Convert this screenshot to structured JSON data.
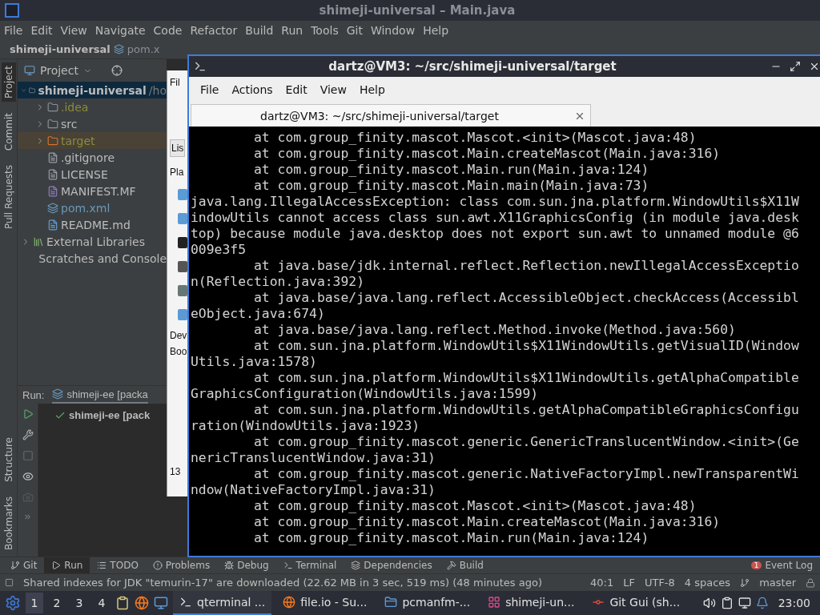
{
  "ide": {
    "title": "shimeji-universal – Main.java",
    "menu": [
      "File",
      "Edit",
      "View",
      "Navigate",
      "Code",
      "Refactor",
      "Build",
      "Run",
      "Tools",
      "Git",
      "Window",
      "Help"
    ],
    "breadcrumb": [
      {
        "label": "shimeji-universal",
        "kind": "project"
      },
      {
        "label": "pom.x",
        "kind": "maven"
      }
    ],
    "stripe_top": [
      {
        "label": "Project",
        "selected": true
      },
      {
        "label": "Commit",
        "selected": false
      },
      {
        "label": "Pull Requests",
        "selected": false
      }
    ],
    "stripe_bottom": [
      {
        "label": "Structure",
        "selected": false
      },
      {
        "label": "Bookmarks",
        "selected": false
      }
    ],
    "project_panel": {
      "title": "Project",
      "tree": [
        {
          "label": "shimeji-universal",
          "path": "/ho",
          "kind": "module",
          "expanded": true,
          "selected": true,
          "children": [
            {
              "label": ".idea",
              "kind": "folder",
              "color": "#8c8c3a",
              "expanded": false,
              "selected": false
            },
            {
              "label": "src",
              "kind": "folder",
              "color": "#bbbbbb",
              "expanded": false,
              "selected": false
            },
            {
              "label": "target",
              "kind": "excluded",
              "color": "#8c8c3a",
              "expanded": false,
              "selected": false
            },
            {
              "label": ".gitignore",
              "kind": "file",
              "color": "#bbbbbb",
              "selected": false
            },
            {
              "label": "LICENSE",
              "kind": "file",
              "color": "#bbbbbb",
              "selected": false
            },
            {
              "label": "MANIFEST.MF",
              "kind": "manifest",
              "color": "#bbbbbb",
              "selected": false
            },
            {
              "label": "pom.xml",
              "kind": "maven",
              "color": "#6897bb",
              "selected": false
            },
            {
              "label": "README.md",
              "kind": "markdown",
              "color": "#bbbbbb",
              "selected": false
            }
          ]
        },
        {
          "label": "External Libraries",
          "kind": "libraries",
          "expanded": false,
          "selected": false
        },
        {
          "label": "Scratches and Console",
          "kind": "scratches",
          "selected": false
        }
      ]
    },
    "run_panel": {
      "label": "Run:",
      "tab": "shimeji-ee [packa",
      "rows": [
        {
          "label": "shimeji-ee [pack",
          "succeeded": true
        }
      ]
    },
    "tool_tabs": [
      {
        "label": "Git",
        "kind": "git",
        "selected": false
      },
      {
        "label": "Run",
        "kind": "run",
        "selected": true
      },
      {
        "label": "TODO",
        "kind": "todo",
        "selected": false
      },
      {
        "label": "Problems",
        "kind": "problems",
        "selected": false
      },
      {
        "label": "Debug",
        "kind": "debug",
        "selected": false
      },
      {
        "label": "Terminal",
        "kind": "terminal",
        "selected": false
      },
      {
        "label": "Dependencies",
        "kind": "dependencies",
        "selected": false
      },
      {
        "label": "Build",
        "kind": "build",
        "selected": false
      }
    ],
    "event_log": {
      "label": "Event Log",
      "badge": "1"
    },
    "status_bar": {
      "message": "Shared indexes for JDK \"temurin-17\" are downloaded (22.62 MB in 3 sec, 519 ms) (48 minutes ago)",
      "items": [
        {
          "label": "40:1",
          "kind": "text"
        },
        {
          "label": "LF",
          "kind": "text"
        },
        {
          "label": "UTF-8",
          "kind": "text"
        },
        {
          "label": "4 spaces",
          "kind": "text"
        },
        {
          "label": "master",
          "kind": "branch"
        }
      ]
    }
  },
  "file_manager": {
    "menu_item": "Fil",
    "view_button": "Lis",
    "sections": [
      "Pla",
      "Dev",
      "Boo"
    ],
    "status": "13"
  },
  "terminal": {
    "title": "dartz@VM3: ~/src/shimeji-universal/target",
    "menu": [
      "File",
      "Actions",
      "Edit",
      "View",
      "Help"
    ],
    "tab": "dartz@VM3: ~/src/shimeji-universal/target",
    "lines": [
      "        at com.group_finity.mascot.Mascot.<init>(Mascot.java:48)",
      "        at com.group_finity.mascot.Main.createMascot(Main.java:316)",
      "        at com.group_finity.mascot.Main.run(Main.java:124)",
      "        at com.group_finity.mascot.Main.main(Main.java:73)",
      "java.lang.IllegalAccessException: class com.sun.jna.platform.WindowUtils$X11W",
      "indowUtils cannot access class sun.awt.X11GraphicsConfig (in module java.desk",
      "top) because module java.desktop does not export sun.awt to unnamed module @6",
      "009e3f5",
      "        at java.base/jdk.internal.reflect.Reflection.newIllegalAccessExceptio",
      "n(Reflection.java:392)",
      "        at java.base/java.lang.reflect.AccessibleObject.checkAccess(Accessibl",
      "eObject.java:674)",
      "        at java.base/java.lang.reflect.Method.invoke(Method.java:560)",
      "        at com.sun.jna.platform.WindowUtils$X11WindowUtils.getVisualID(Window",
      "Utils.java:1578)",
      "        at com.sun.jna.platform.WindowUtils$X11WindowUtils.getAlphaCompatible",
      "GraphicsConfiguration(WindowUtils.java:1599)",
      "        at com.sun.jna.platform.WindowUtils.getAlphaCompatibleGraphicsConfigu",
      "ration(WindowUtils.java:1923)",
      "        at com.group_finity.mascot.generic.GenericTranslucentWindow.<init>(Ge",
      "nericTranslucentWindow.java:31)",
      "        at com.group_finity.mascot.generic.NativeFactoryImpl.newTransparentWi",
      "ndow(NativeFactoryImpl.java:31)",
      "        at com.group_finity.mascot.Mascot.<init>(Mascot.java:48)",
      "        at com.group_finity.mascot.Main.createMascot(Main.java:316)",
      "        at com.group_finity.mascot.Main.run(Main.java:124)"
    ]
  },
  "taskbar": {
    "workspaces": [
      {
        "label": "1",
        "selected": true
      },
      {
        "label": "2",
        "selected": false
      },
      {
        "label": "3",
        "selected": false
      },
      {
        "label": "4",
        "selected": false
      }
    ],
    "tasks": [
      {
        "label": "qterminal ...",
        "kind": "terminal",
        "selected": true
      },
      {
        "label": "file.io - Su...",
        "kind": "browser",
        "selected": false
      },
      {
        "label": "pcmanfm-...",
        "kind": "folder",
        "selected": false
      },
      {
        "label": "shimeji-un...",
        "kind": "ide",
        "selected": false
      },
      {
        "label": "Git Gui (sh...",
        "kind": "git",
        "selected": false
      }
    ],
    "clock": "23:00"
  }
}
